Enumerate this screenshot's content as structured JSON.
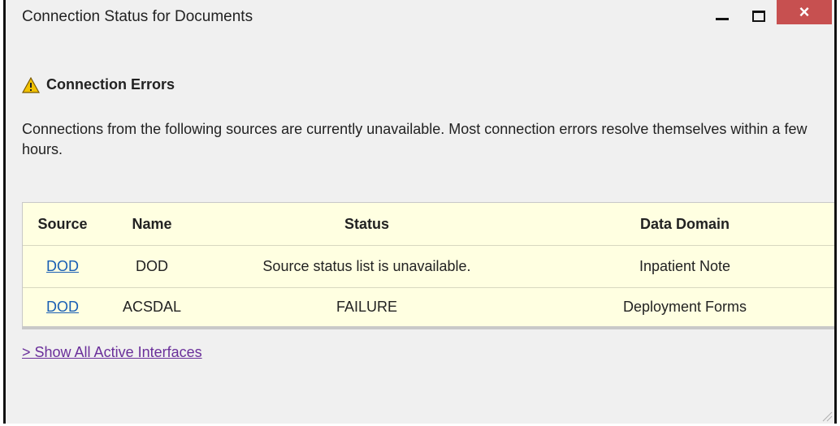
{
  "window": {
    "title": "Connection Status for Documents",
    "minimize_icon": "minimize-icon",
    "maximize_icon": "maximize-icon",
    "close_label": "×"
  },
  "errors": {
    "icon": "warning-icon",
    "heading": "Connection Errors",
    "description": "Connections from the following sources are currently unavailable. Most connection errors resolve themselves within a few hours."
  },
  "table": {
    "headers": [
      "Source",
      "Name",
      "Status",
      "Data Domain"
    ],
    "rows": [
      {
        "source": "DOD",
        "name": "DOD",
        "status": "Source status list is unavailable.",
        "domain": "Inpatient Note"
      },
      {
        "source": "DOD",
        "name": "ACSDAL",
        "status": "FAILURE",
        "domain": "Deployment Forms"
      }
    ]
  },
  "links": {
    "show_all": "> Show All Active Interfaces"
  },
  "colors": {
    "close_button": "#c75050",
    "table_background": "#ffffe1",
    "link": "#1a5fb4",
    "visited_link": "#6a2f9a",
    "warning": "#f2c200"
  }
}
